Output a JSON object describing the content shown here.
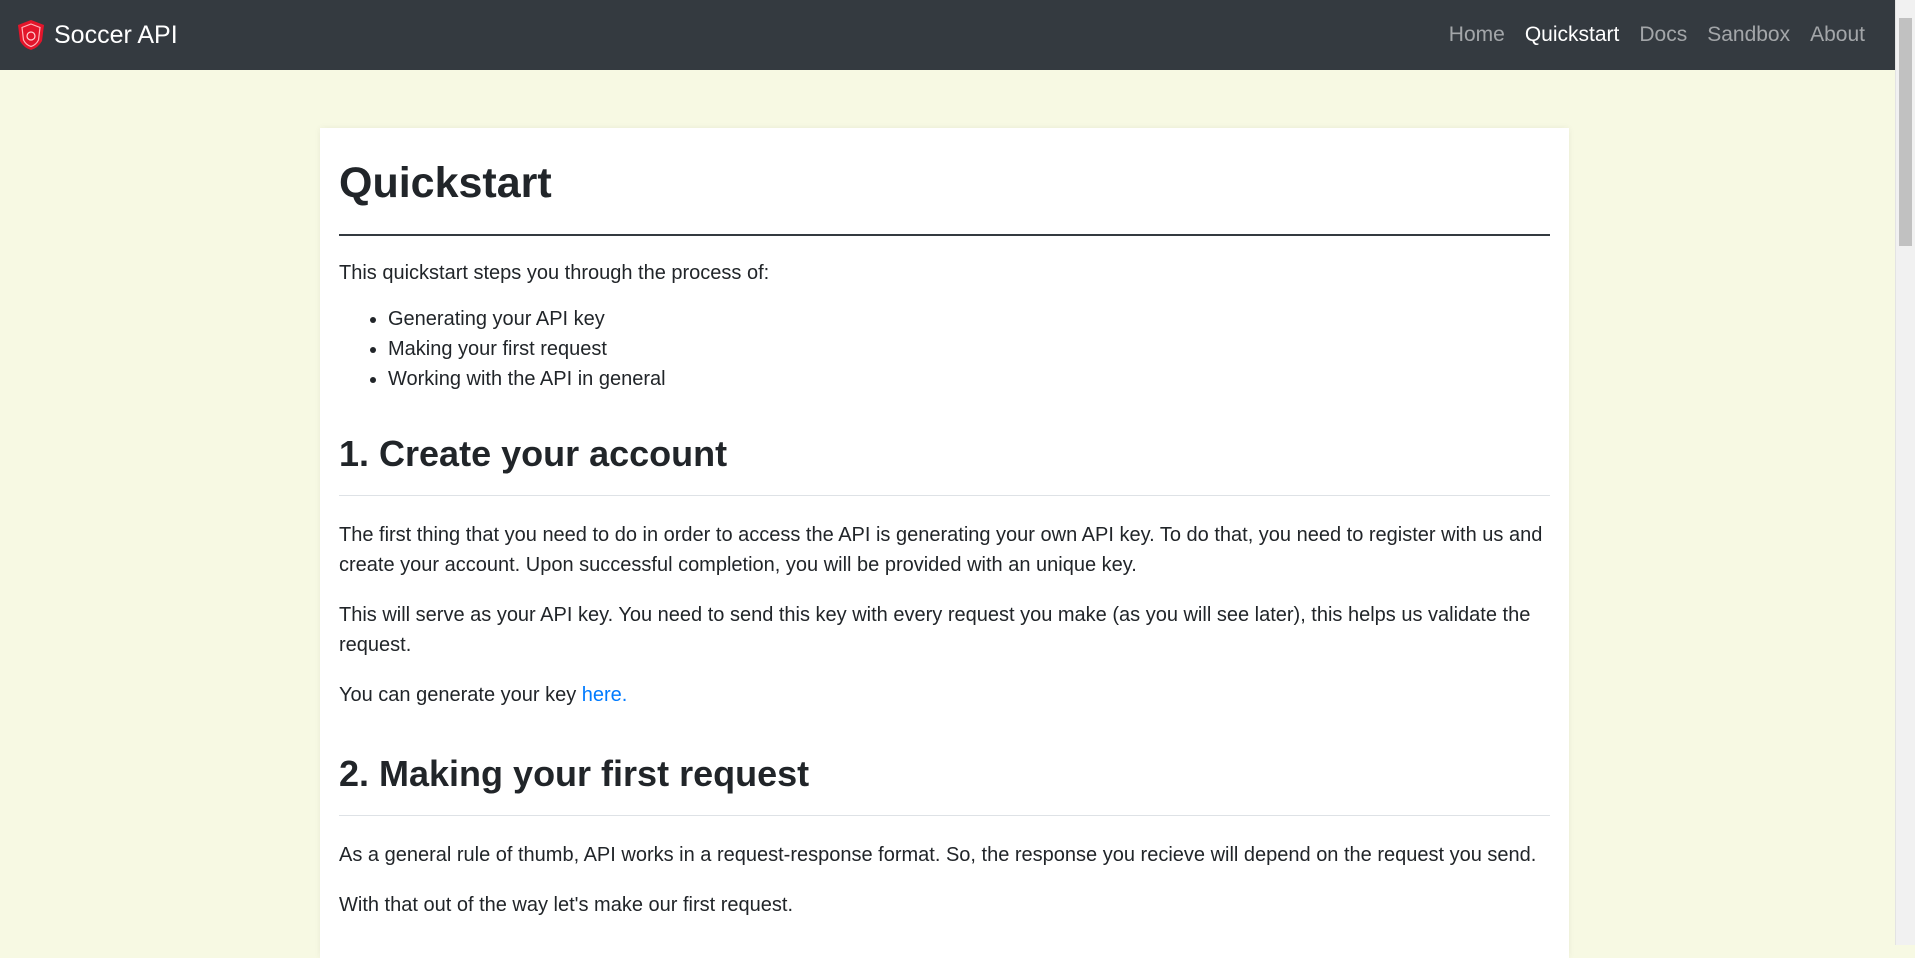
{
  "navbar": {
    "brand": "Soccer API",
    "links": [
      {
        "label": "Home"
      },
      {
        "label": "Quickstart"
      },
      {
        "label": "Docs"
      },
      {
        "label": "Sandbox"
      },
      {
        "label": "About"
      }
    ],
    "active": "Quickstart"
  },
  "page": {
    "title": "Quickstart",
    "intro": "This quickstart steps you through the process of:",
    "steps": [
      "Generating your API key",
      "Making your first request",
      "Working with the API in general"
    ],
    "section1": {
      "heading": "1. Create your account",
      "p1": "The first thing that you need to do in order to access the API is generating your own API key. To do that, you need to register with us and create your account. Upon successful completion, you will be provided with an unique key.",
      "p2": "This will serve as your API key. You need to send this key with every request you make (as you will see later), this helps us validate the request.",
      "p3_prefix": "You can generate your key ",
      "p3_link": "here."
    },
    "section2": {
      "heading": "2. Making your first request",
      "p1": "As a general rule of thumb, API works in a request-response format. So, the response you recieve will depend on the request you send.",
      "p2": "With that out of the way let's make our first request."
    }
  },
  "colors": {
    "navbar_bg": "#343a40",
    "page_bg": "#f7f9e3",
    "link": "#007bff",
    "logo_red": "#e3152b"
  },
  "icons": {
    "brand_logo": "shield-soccer-logo"
  }
}
